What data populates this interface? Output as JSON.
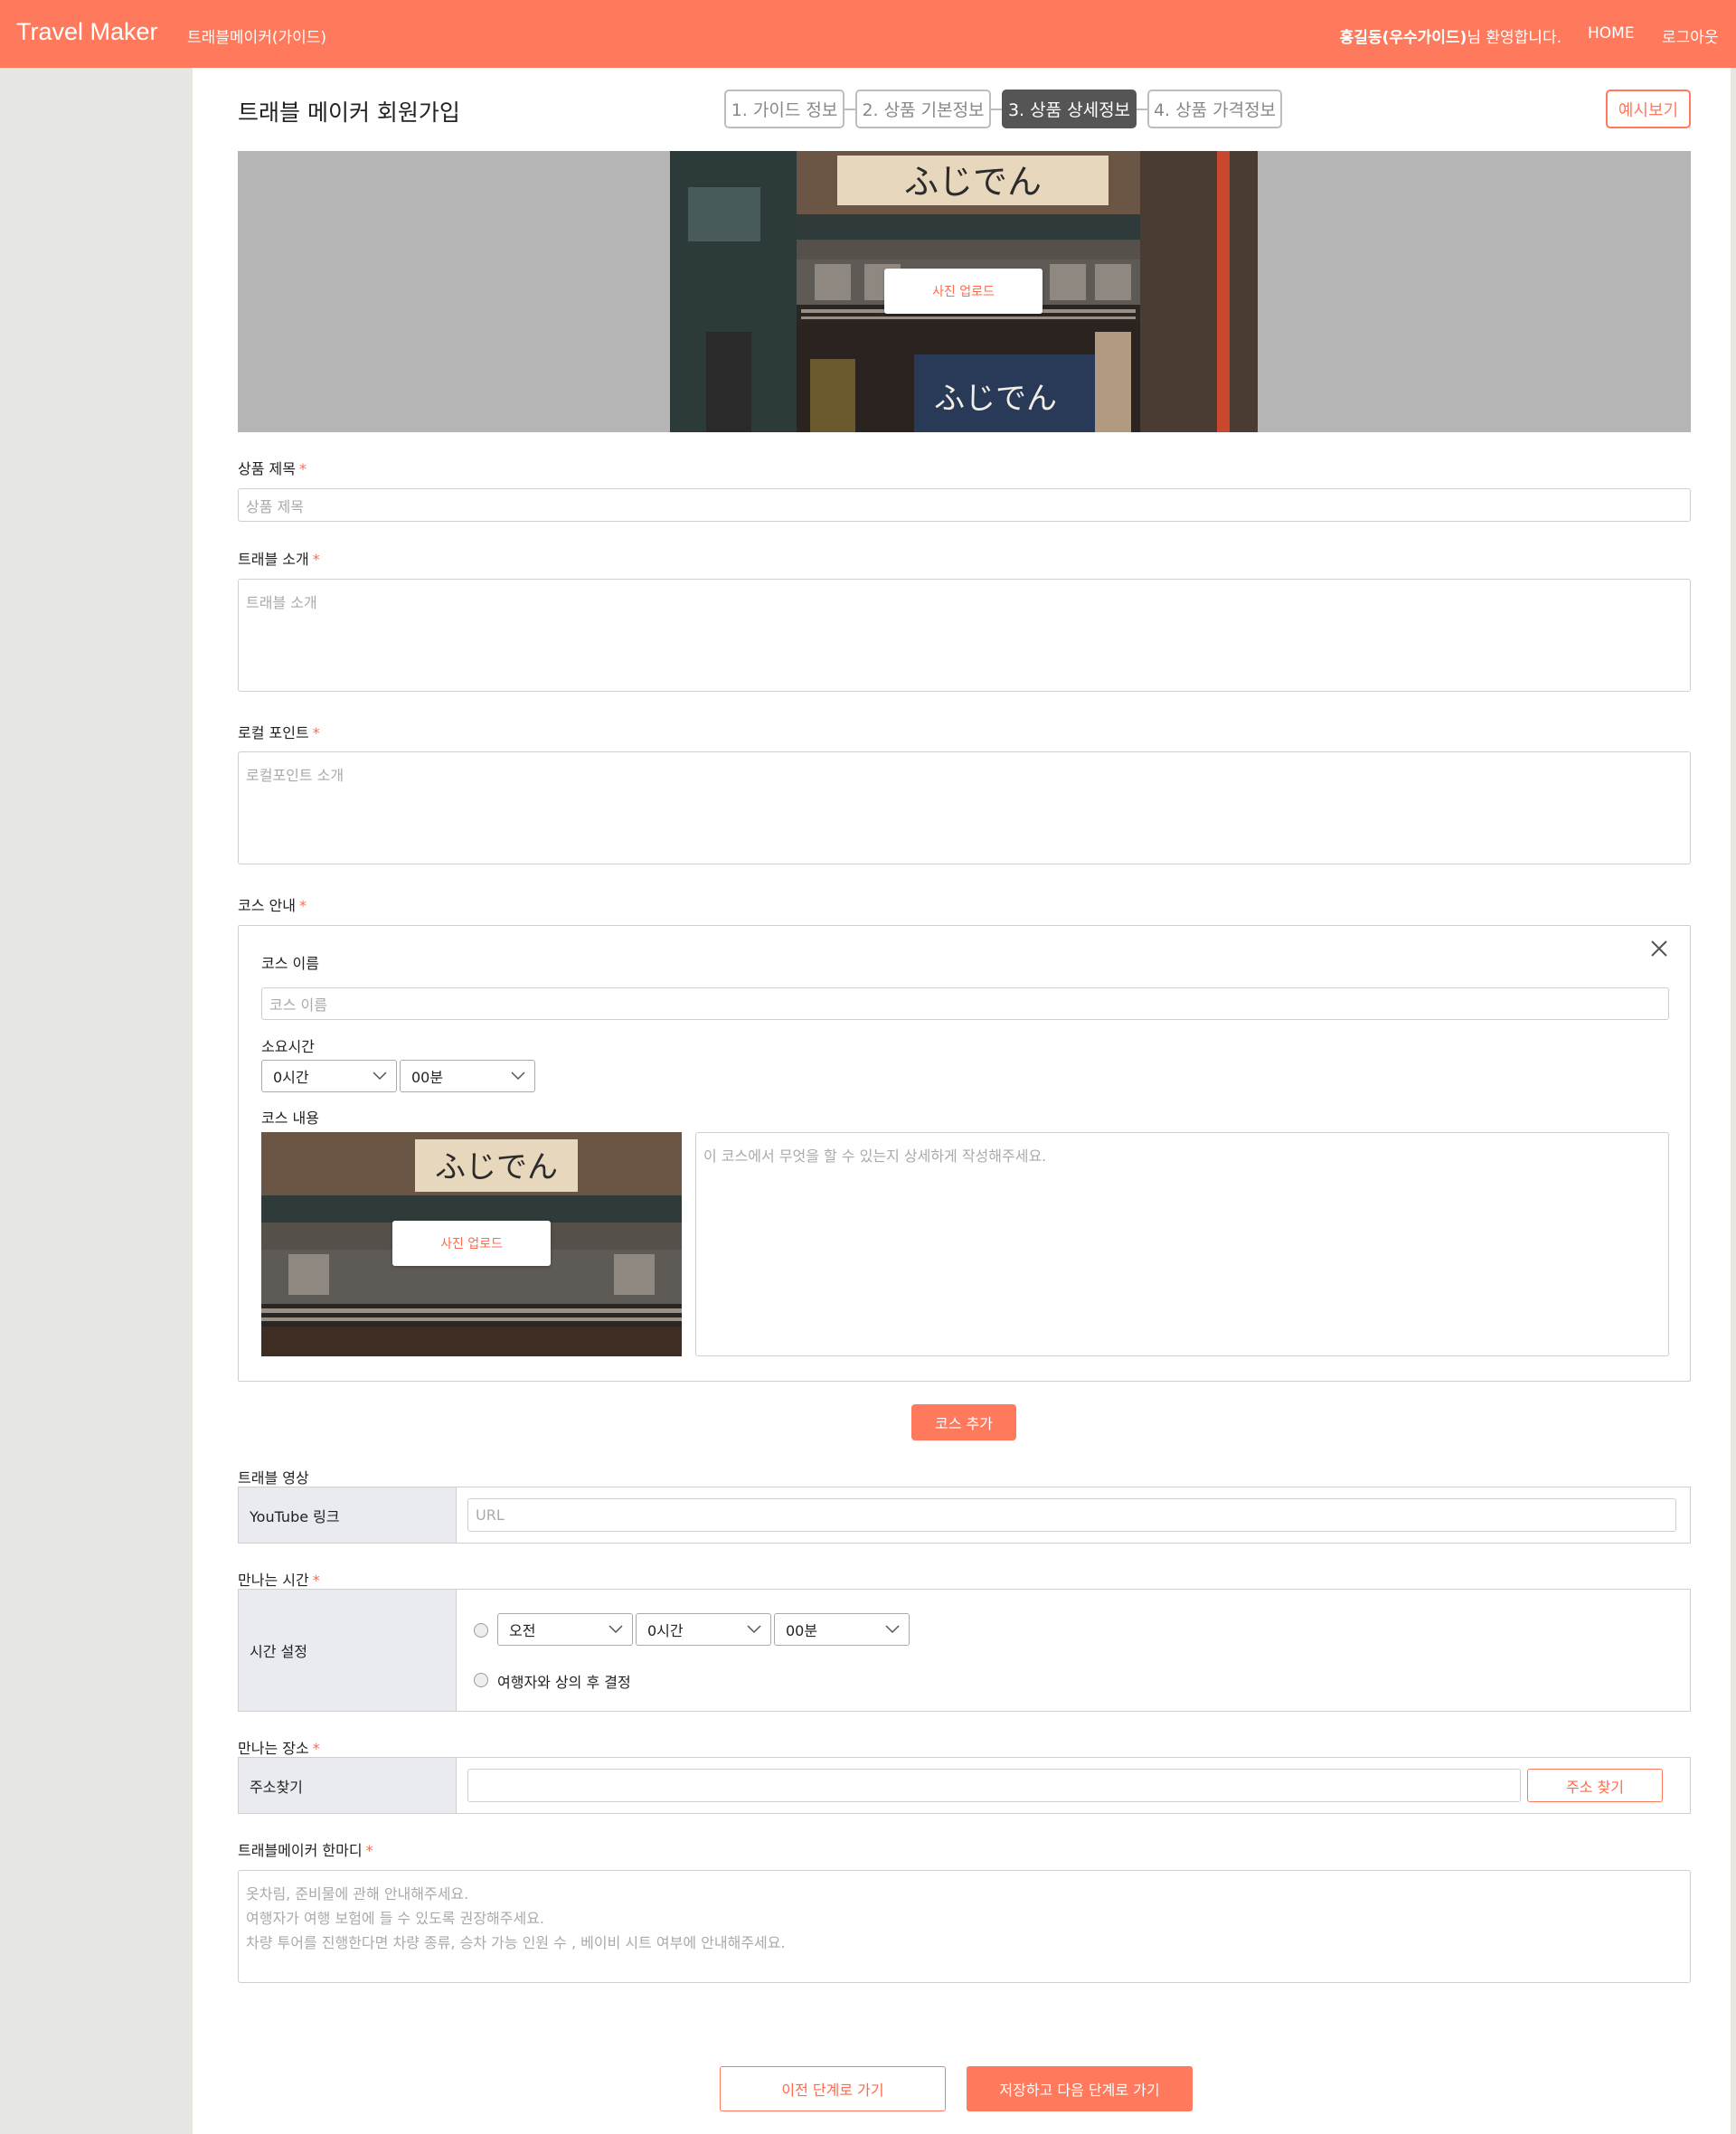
{
  "header": {
    "brand": "Travel Maker",
    "subnav": "트래블메이커(가이드)",
    "welcome_name": "홍길동(우수가이드)",
    "welcome_suffix": "님 환영합니다.",
    "home": "HOME",
    "logout": "로그아웃",
    "bg_color": "#ff7a5c"
  },
  "page": {
    "title": "트래블 메이커 회원가입",
    "preview_button": "예시보기",
    "steps": [
      {
        "label": "1. 가이드 정보",
        "active": false
      },
      {
        "label": "2. 상품 기본정보",
        "active": false
      },
      {
        "label": "3. 상품 상세정보",
        "active": true
      },
      {
        "label": "4. 상품 가격정보",
        "active": false
      }
    ]
  },
  "banner": {
    "upload_label": "사진 업로드"
  },
  "form": {
    "title_label": "상품 제목",
    "title_placeholder": "상품 제목",
    "intro_label": "트래블 소개",
    "intro_placeholder": "트래블 소개",
    "local_label": "로컬 포인트",
    "local_placeholder": "로컬포인트 소개",
    "course_label": "코스 안내",
    "required_mark": "*"
  },
  "course": {
    "name_label": "코스 이름",
    "name_placeholder": "코스 이름",
    "duration_label": "소요시간",
    "hours_value": "0시간",
    "minutes_value": "00분",
    "content_label": "코스 내용",
    "upload_label": "사진 업로드",
    "content_placeholder": "이 코스에서 무엇을 할 수 있는지 상세하게 작성해주세요.",
    "add_button": "코스 추가"
  },
  "video": {
    "section_label": "트래블 영상",
    "row_header": "YouTube 링크",
    "url_placeholder": "URL"
  },
  "meeting_time": {
    "section_label": "만나는 시간",
    "row_header": "시간 설정",
    "ampm_value": "오전",
    "hours_value": "0시간",
    "minutes_value": "00분",
    "option2_label": "여행자와 상의 후 결정"
  },
  "meeting_place": {
    "section_label": "만나는 장소",
    "row_header": "주소찾기",
    "search_button": "주소 찾기"
  },
  "comment": {
    "section_label": "트래블메이커 한마디",
    "placeholder": "옷차림, 준비물에 관해 안내해주세요.\n여행자가 여행 보험에 들 수 있도록 권장해주세요.\n차량 투어를 진행한다면 차량 종류, 승차 가능 인원 수 , 베이비 시트 여부에 안내해주세요."
  },
  "footer": {
    "prev_button": "이전 단계로 가기",
    "next_button": "저장하고 다음 단계로 가기"
  }
}
